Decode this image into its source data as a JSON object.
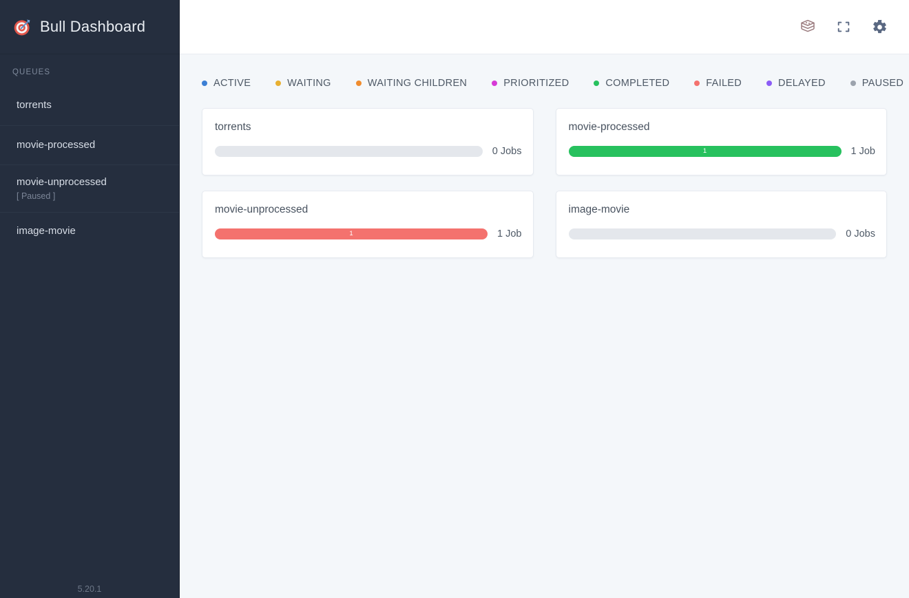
{
  "app": {
    "title": "Bull Dashboard",
    "logo_icon": "target-dart-icon",
    "version": "5.20.1"
  },
  "sidebar": {
    "section_label": "QUEUES",
    "items": [
      {
        "name": "torrents",
        "state": ""
      },
      {
        "name": "movie-processed",
        "state": ""
      },
      {
        "name": "movie-unprocessed",
        "state": "[ Paused ]"
      },
      {
        "name": "image-movie",
        "state": ""
      }
    ]
  },
  "topbar": {
    "icons": [
      {
        "name": "redis-layers-icon",
        "label": "Redis",
        "color": "#9b7c7f"
      },
      {
        "name": "fullscreen-icon",
        "label": "Fullscreen",
        "color": "#5a6882"
      },
      {
        "name": "gear-icon",
        "label": "Settings",
        "color": "#5a6882"
      }
    ]
  },
  "legend": [
    {
      "label": "ACTIVE",
      "color": "#3b7fd4"
    },
    {
      "label": "WAITING",
      "color": "#e8b031"
    },
    {
      "label": "WAITING CHILDREN",
      "color": "#f08c2e"
    },
    {
      "label": "PRIORITIZED",
      "color": "#d63ad6"
    },
    {
      "label": "COMPLETED",
      "color": "#27c15e"
    },
    {
      "label": "FAILED",
      "color": "#f4726e"
    },
    {
      "label": "DELAYED",
      "color": "#8b5cf6"
    },
    {
      "label": "PAUSED",
      "color": "#9ca3ad"
    }
  ],
  "cards": [
    {
      "title": "torrents",
      "jobs_text": "0 Jobs",
      "segments": []
    },
    {
      "title": "movie-processed",
      "jobs_text": "1 Job",
      "segments": [
        {
          "status": "completed",
          "count": "1",
          "percent": 100,
          "color": "#27c15e"
        }
      ]
    },
    {
      "title": "movie-unprocessed",
      "jobs_text": "1 Job",
      "segments": [
        {
          "status": "failed",
          "count": "1",
          "percent": 100,
          "color": "#f4726e"
        }
      ]
    },
    {
      "title": "image-movie",
      "jobs_text": "0 Jobs",
      "segments": []
    }
  ],
  "colors": {
    "sidebar_bg": "#252e3e",
    "content_bg": "#f4f7fa",
    "card_bg": "#ffffff",
    "track_bg": "#e4e7ec"
  }
}
